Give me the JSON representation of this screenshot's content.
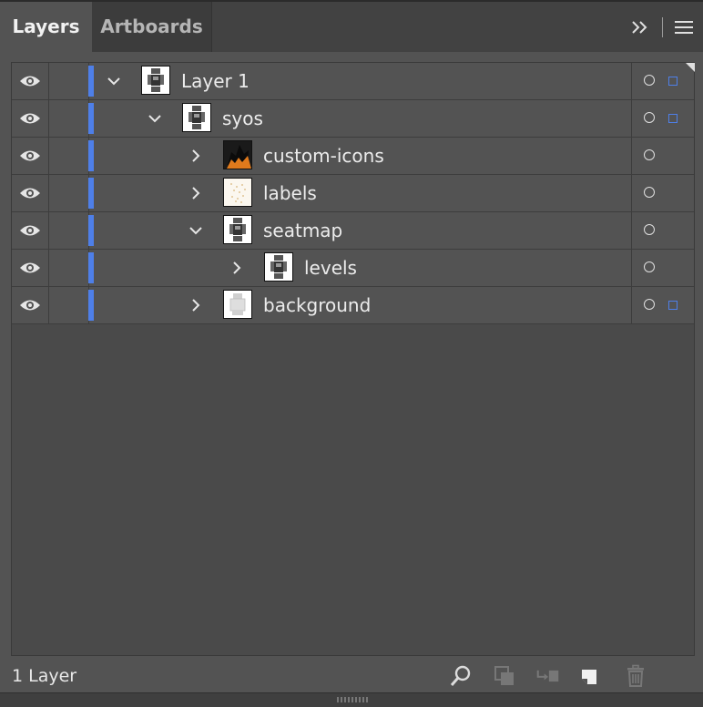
{
  "tabs": [
    {
      "label": "Layers",
      "active": true
    },
    {
      "label": "Artboards",
      "active": false
    }
  ],
  "panel_icons": [
    "collapse-icon",
    "panel-menu-icon"
  ],
  "colors": {
    "layer_color": "#4e7fe8",
    "panel_bg": "#535353",
    "tab_bg": "#424242"
  },
  "layers": [
    {
      "name": "Layer 1",
      "depth": 0,
      "expanded": true,
      "visible": true,
      "selected_art": true,
      "thumbnail": "robot-map-thumbnail"
    },
    {
      "name": "syos",
      "depth": 1,
      "expanded": true,
      "visible": true,
      "selected_art": true,
      "thumbnail": "robot-map-thumbnail"
    },
    {
      "name": "custom-icons",
      "depth": 2,
      "expanded": false,
      "visible": true,
      "selected_art": false,
      "thumbnail": "dark-icons-thumbnail"
    },
    {
      "name": "labels",
      "depth": 2,
      "expanded": false,
      "visible": true,
      "selected_art": false,
      "thumbnail": "dotted-labels-thumbnail"
    },
    {
      "name": "seatmap",
      "depth": 2,
      "expanded": true,
      "visible": true,
      "selected_art": false,
      "thumbnail": "robot-map-thumbnail"
    },
    {
      "name": "levels",
      "depth": 3,
      "expanded": false,
      "visible": true,
      "selected_art": false,
      "thumbnail": "robot-map-thumbnail"
    },
    {
      "name": "background",
      "depth": 2,
      "expanded": false,
      "visible": true,
      "selected_art": true,
      "thumbnail": "light-map-thumbnail"
    }
  ],
  "footer": {
    "layer_count": "1 Layer",
    "icons": [
      "locate-object-icon",
      "make-clipping-mask-icon",
      "create-sublayer-icon",
      "new-layer-icon",
      "delete-icon"
    ]
  }
}
